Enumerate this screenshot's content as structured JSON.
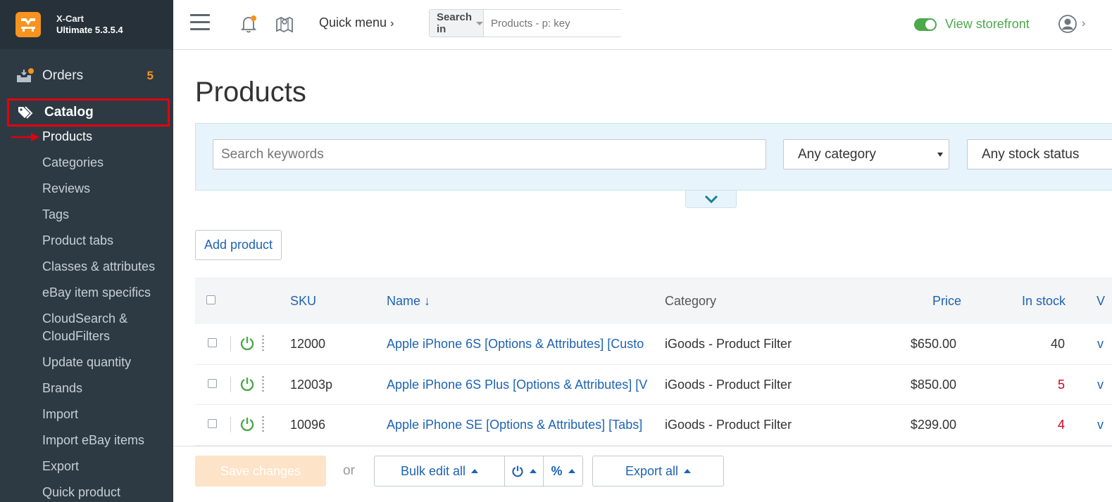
{
  "brand": {
    "name": "X-Cart",
    "edition": "Ultimate 5.3.5.4"
  },
  "sidebar": {
    "orders_label": "Orders",
    "orders_count": "5",
    "catalog_label": "Catalog",
    "items": [
      {
        "label": "Products"
      },
      {
        "label": "Categories"
      },
      {
        "label": "Reviews"
      },
      {
        "label": "Tags"
      },
      {
        "label": "Product tabs"
      },
      {
        "label": "Classes & attributes"
      },
      {
        "label": "eBay item specifics"
      },
      {
        "label": "CloudSearch & CloudFilters"
      },
      {
        "label": "Update quantity"
      },
      {
        "label": "Brands"
      },
      {
        "label": "Import"
      },
      {
        "label": "Import eBay items"
      },
      {
        "label": "Export"
      },
      {
        "label": "Quick product"
      }
    ]
  },
  "header": {
    "quick_menu": "Quick menu",
    "search_in": "Search in",
    "search_placeholder": "Products - p: key",
    "view_storefront": "View storefront"
  },
  "main": {
    "title": "Products",
    "keyword_placeholder": "Search keywords",
    "category_select": "Any category",
    "stock_select": "Any stock status",
    "add_product": "Add product"
  },
  "table": {
    "headers": {
      "sku": "SKU",
      "name": "Name ↓",
      "category": "Category",
      "price": "Price",
      "in_stock": "In stock",
      "extra": "V"
    },
    "rows": [
      {
        "sku": "12000",
        "name": "Apple iPhone 6S [Options & Attributes] [Custo",
        "category": "iGoods - Product Filter",
        "price": "$650.00",
        "stock": "40",
        "extra": "v"
      },
      {
        "sku": "12003p",
        "name": "Apple iPhone 6S Plus [Options & Attributes] [V",
        "category": "iGoods - Product Filter",
        "price": "$850.00",
        "stock": "5",
        "extra": "v"
      },
      {
        "sku": "10096",
        "name": "Apple iPhone SE [Options & Attributes] [Tabs]",
        "category": "iGoods - Product Filter",
        "price": "$299.00",
        "stock": "4",
        "extra": "v"
      }
    ]
  },
  "bottom": {
    "save": "Save changes",
    "or": "or",
    "bulk_edit": "Bulk edit all",
    "percent": "%",
    "export_all": "Export all"
  }
}
